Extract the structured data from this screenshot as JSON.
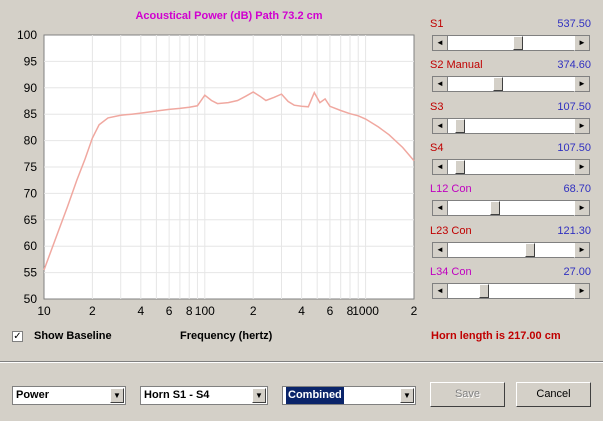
{
  "chart_data": {
    "type": "line",
    "title": "Acoustical Power (dB)   Path 73.2 cm",
    "xlabel": "Frequency (hertz)",
    "ylabel": "",
    "xscale": "log",
    "xlim": [
      10,
      2000
    ],
    "ylim": [
      50,
      100
    ],
    "yticks": [
      "100",
      "95",
      "90",
      "85",
      "80",
      "75",
      "70",
      "65",
      "60",
      "55",
      "50"
    ],
    "xticks": [
      {
        "value": 10,
        "label": "10"
      },
      {
        "value": 20,
        "label": "2"
      },
      {
        "value": 40,
        "label": "4"
      },
      {
        "value": 60,
        "label": "6"
      },
      {
        "value": 80,
        "label": "8"
      },
      {
        "value": 100,
        "label": "100"
      },
      {
        "value": 200,
        "label": "2"
      },
      {
        "value": 400,
        "label": "4"
      },
      {
        "value": 600,
        "label": "6"
      },
      {
        "value": 800,
        "label": "8"
      },
      {
        "value": 1000,
        "label": "1000"
      },
      {
        "value": 2000,
        "label": "2"
      }
    ],
    "grid": true,
    "series": [
      {
        "color": "#f0a8a0",
        "x": [
          10,
          12,
          14,
          16,
          18,
          20,
          22,
          25,
          30,
          35,
          40,
          50,
          60,
          70,
          80,
          90,
          100,
          110,
          120,
          140,
          160,
          180,
          200,
          220,
          240,
          270,
          300,
          330,
          360,
          400,
          440,
          480,
          520,
          560,
          600,
          700,
          800,
          900,
          1000,
          1200,
          1400,
          1700,
          2000
        ],
        "y": [
          55.5,
          62,
          67.5,
          72.5,
          76.5,
          80.5,
          83,
          84.3,
          84.8,
          85.0,
          85.2,
          85.6,
          85.9,
          86.1,
          86.3,
          86.6,
          88.6,
          87.6,
          87.0,
          87.2,
          87.6,
          88.4,
          89.2,
          88.4,
          87.6,
          88.2,
          88.8,
          87.4,
          86.7,
          86.5,
          86.4,
          89.1,
          87.2,
          87.9,
          86.5,
          85.7,
          85.1,
          84.7,
          84.1,
          82.6,
          81.1,
          78.7,
          76.2
        ]
      }
    ]
  },
  "controls": {
    "show_baseline_label": "Show Baseline",
    "show_baseline_checked": "✓",
    "horn_length": "Horn length is 217.00 cm",
    "sliders": [
      {
        "label": "S1",
        "value": "537.50",
        "pos": 0.55,
        "color": "#c00000"
      },
      {
        "label": "S2  Manual",
        "value": "374.60",
        "pos": 0.38,
        "color": "#c00000"
      },
      {
        "label": "S3",
        "value": "107.50",
        "pos": 0.07,
        "color": "#c00000"
      },
      {
        "label": "S4",
        "value": "107.50",
        "pos": 0.07,
        "color": "#c00000"
      },
      {
        "label": "L12  Con",
        "value": "68.70",
        "pos": 0.36,
        "color": "#c000c0"
      },
      {
        "label": "L23  Con",
        "value": "121.30",
        "pos": 0.65,
        "color": "#c00000"
      },
      {
        "label": "L34  Con",
        "value": "27.00",
        "pos": 0.27,
        "color": "#c000c0"
      }
    ]
  },
  "bottom": {
    "combo1": "Power",
    "combo2": "Horn S1 - S4",
    "combo3": "Combined",
    "save_label": "Save",
    "cancel_label": "Cancel"
  }
}
